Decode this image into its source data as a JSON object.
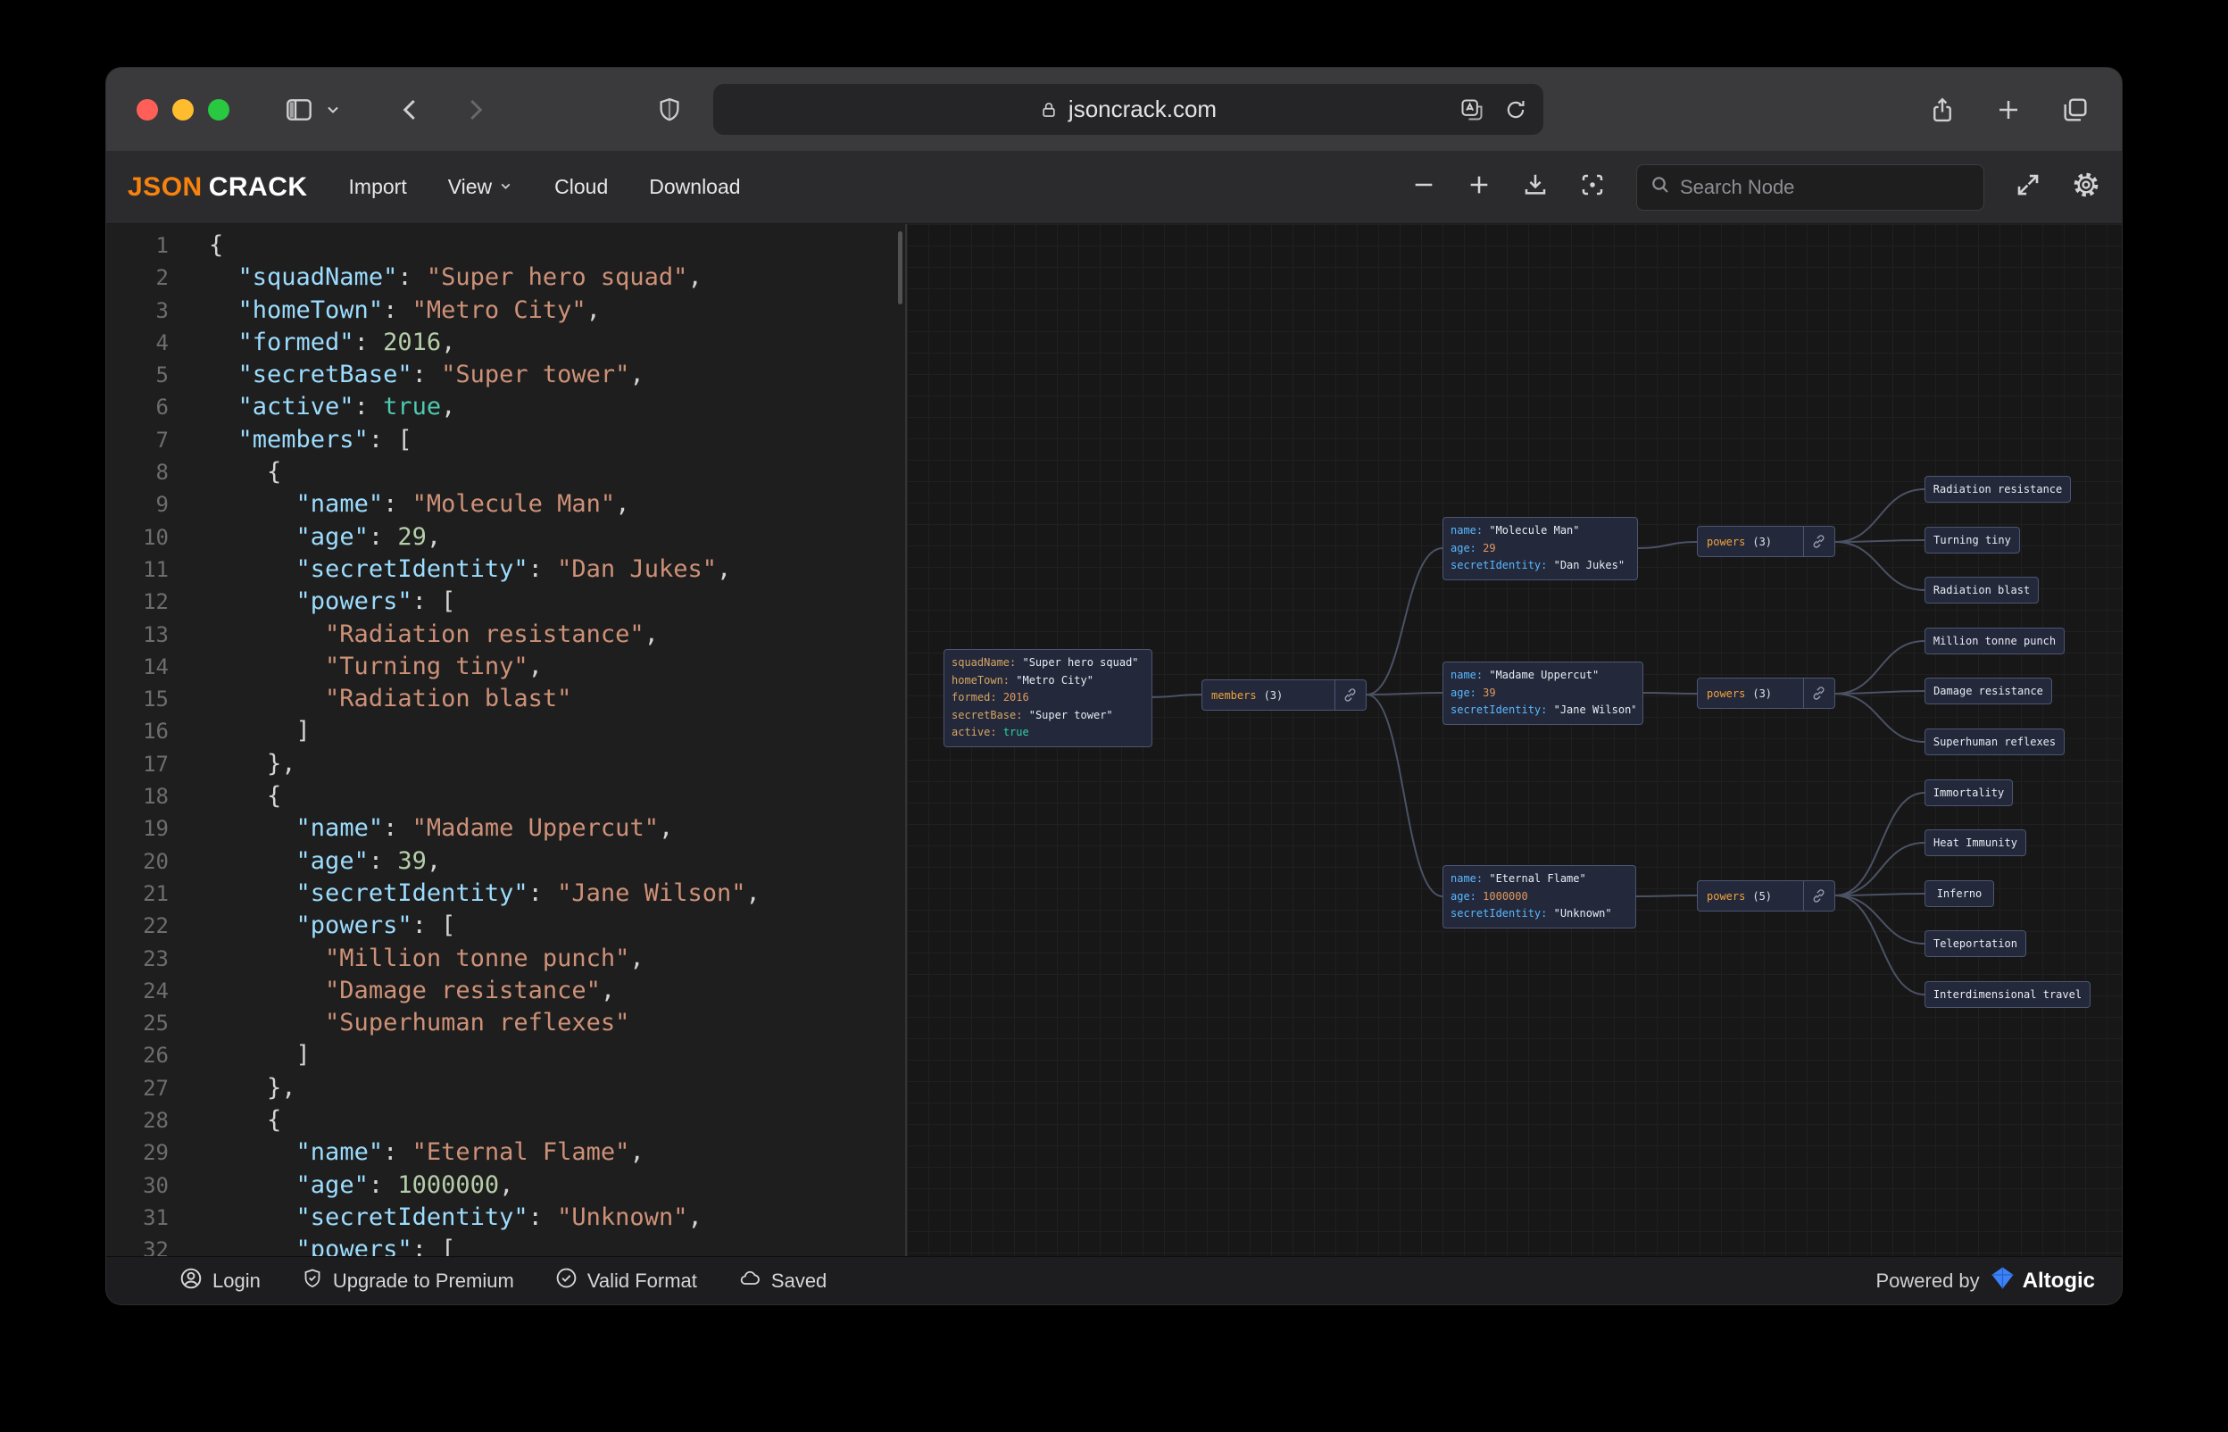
{
  "browser": {
    "url": "jsoncrack.com"
  },
  "toolbar": {
    "logo_json": "JSON",
    "logo_crack": "CRACK",
    "menu": {
      "import": "Import",
      "view": "View",
      "cloud": "Cloud",
      "download": "Download"
    },
    "search_placeholder": "Search Node"
  },
  "editor": {
    "lines": [
      [
        [
          "p",
          "{"
        ]
      ],
      [
        [
          "p",
          "  "
        ],
        [
          "k",
          "\"squadName\""
        ],
        [
          "p",
          ": "
        ],
        [
          "s",
          "\"Super hero squad\""
        ],
        [
          "p",
          ","
        ]
      ],
      [
        [
          "p",
          "  "
        ],
        [
          "k",
          "\"homeTown\""
        ],
        [
          "p",
          ": "
        ],
        [
          "s",
          "\"Metro City\""
        ],
        [
          "p",
          ","
        ]
      ],
      [
        [
          "p",
          "  "
        ],
        [
          "k",
          "\"formed\""
        ],
        [
          "p",
          ": "
        ],
        [
          "n",
          "2016"
        ],
        [
          "p",
          ","
        ]
      ],
      [
        [
          "p",
          "  "
        ],
        [
          "k",
          "\"secretBase\""
        ],
        [
          "p",
          ": "
        ],
        [
          "s",
          "\"Super tower\""
        ],
        [
          "p",
          ","
        ]
      ],
      [
        [
          "p",
          "  "
        ],
        [
          "k",
          "\"active\""
        ],
        [
          "p",
          ": "
        ],
        [
          "b",
          "true"
        ],
        [
          "p",
          ","
        ]
      ],
      [
        [
          "p",
          "  "
        ],
        [
          "k",
          "\"members\""
        ],
        [
          "p",
          ": ["
        ]
      ],
      [
        [
          "p",
          "    {"
        ]
      ],
      [
        [
          "p",
          "      "
        ],
        [
          "k",
          "\"name\""
        ],
        [
          "p",
          ": "
        ],
        [
          "s",
          "\"Molecule Man\""
        ],
        [
          "p",
          ","
        ]
      ],
      [
        [
          "p",
          "      "
        ],
        [
          "k",
          "\"age\""
        ],
        [
          "p",
          ": "
        ],
        [
          "n",
          "29"
        ],
        [
          "p",
          ","
        ]
      ],
      [
        [
          "p",
          "      "
        ],
        [
          "k",
          "\"secretIdentity\""
        ],
        [
          "p",
          ": "
        ],
        [
          "s",
          "\"Dan Jukes\""
        ],
        [
          "p",
          ","
        ]
      ],
      [
        [
          "p",
          "      "
        ],
        [
          "k",
          "\"powers\""
        ],
        [
          "p",
          ": ["
        ]
      ],
      [
        [
          "p",
          "        "
        ],
        [
          "s",
          "\"Radiation resistance\""
        ],
        [
          "p",
          ","
        ]
      ],
      [
        [
          "p",
          "        "
        ],
        [
          "s",
          "\"Turning tiny\""
        ],
        [
          "p",
          ","
        ]
      ],
      [
        [
          "p",
          "        "
        ],
        [
          "s",
          "\"Radiation blast\""
        ]
      ],
      [
        [
          "p",
          "      ]"
        ]
      ],
      [
        [
          "p",
          "    },"
        ]
      ],
      [
        [
          "p",
          "    {"
        ]
      ],
      [
        [
          "p",
          "      "
        ],
        [
          "k",
          "\"name\""
        ],
        [
          "p",
          ": "
        ],
        [
          "s",
          "\"Madame Uppercut\""
        ],
        [
          "p",
          ","
        ]
      ],
      [
        [
          "p",
          "      "
        ],
        [
          "k",
          "\"age\""
        ],
        [
          "p",
          ": "
        ],
        [
          "n",
          "39"
        ],
        [
          "p",
          ","
        ]
      ],
      [
        [
          "p",
          "      "
        ],
        [
          "k",
          "\"secretIdentity\""
        ],
        [
          "p",
          ": "
        ],
        [
          "s",
          "\"Jane Wilson\""
        ],
        [
          "p",
          ","
        ]
      ],
      [
        [
          "p",
          "      "
        ],
        [
          "k",
          "\"powers\""
        ],
        [
          "p",
          ": ["
        ]
      ],
      [
        [
          "p",
          "        "
        ],
        [
          "s",
          "\"Million tonne punch\""
        ],
        [
          "p",
          ","
        ]
      ],
      [
        [
          "p",
          "        "
        ],
        [
          "s",
          "\"Damage resistance\""
        ],
        [
          "p",
          ","
        ]
      ],
      [
        [
          "p",
          "        "
        ],
        [
          "s",
          "\"Superhuman reflexes\""
        ]
      ],
      [
        [
          "p",
          "      ]"
        ]
      ],
      [
        [
          "p",
          "    },"
        ]
      ],
      [
        [
          "p",
          "    {"
        ]
      ],
      [
        [
          "p",
          "      "
        ],
        [
          "k",
          "\"name\""
        ],
        [
          "p",
          ": "
        ],
        [
          "s",
          "\"Eternal Flame\""
        ],
        [
          "p",
          ","
        ]
      ],
      [
        [
          "p",
          "      "
        ],
        [
          "k",
          "\"age\""
        ],
        [
          "p",
          ": "
        ],
        [
          "n",
          "1000000"
        ],
        [
          "p",
          ","
        ]
      ],
      [
        [
          "p",
          "      "
        ],
        [
          "k",
          "\"secretIdentity\""
        ],
        [
          "p",
          ": "
        ],
        [
          "s",
          "\"Unknown\""
        ],
        [
          "p",
          ","
        ]
      ],
      [
        [
          "p",
          "      "
        ],
        [
          "k",
          "\"powers\""
        ],
        [
          "p",
          ": ["
        ]
      ]
    ]
  },
  "graph": {
    "root": {
      "rows": [
        {
          "k": "squadName:",
          "v": "\"Super hero squad\""
        },
        {
          "k": "homeTown:",
          "v": "\"Metro City\""
        },
        {
          "k": "formed:",
          "v": "2016"
        },
        {
          "k": "secretBase:",
          "v": "\"Super tower\""
        },
        {
          "k": "active:",
          "v": "true"
        }
      ]
    },
    "members_label": "members",
    "members_count": "(3)",
    "members": [
      {
        "rows": [
          {
            "k": "name:",
            "v": "\"Molecule Man\""
          },
          {
            "k": "age:",
            "v": "29"
          },
          {
            "k": "secretIdentity:",
            "v": "\"Dan Jukes\""
          }
        ]
      },
      {
        "rows": [
          {
            "k": "name:",
            "v": "\"Madame Uppercut\""
          },
          {
            "k": "age:",
            "v": "39"
          },
          {
            "k": "secretIdentity:",
            "v": "\"Jane Wilson\""
          }
        ]
      },
      {
        "rows": [
          {
            "k": "name:",
            "v": "\"Eternal Flame\""
          },
          {
            "k": "age:",
            "v": "1000000"
          },
          {
            "k": "secretIdentity:",
            "v": "\"Unknown\""
          }
        ]
      }
    ],
    "powers": [
      {
        "label": "powers",
        "count": "(3)"
      },
      {
        "label": "powers",
        "count": "(3)"
      },
      {
        "label": "powers",
        "count": "(5)"
      }
    ],
    "leaves": [
      "Radiation resistance",
      "Turning tiny",
      "Radiation blast",
      "Million tonne punch",
      "Damage resistance",
      "Superhuman reflexes",
      "Immortality",
      "Heat Immunity",
      "Inferno",
      "Teleportation",
      "Interdimensional travel"
    ]
  },
  "statusbar": {
    "login": "Login",
    "upgrade": "Upgrade to Premium",
    "valid": "Valid Format",
    "saved": "Saved",
    "powered_by": "Powered by",
    "brand": "Altogic"
  },
  "colors": {
    "brand_orange": "#f7820d",
    "node_key_blue": "#59b8ff",
    "node_key_gold": "#d7a65f",
    "node_label_orange": "#f2a33c",
    "string_orange": "#ce9178",
    "number_green": "#b5cea8",
    "bool_teal": "#4ec9b0",
    "traffic_red": "#ff5f57",
    "traffic_yellow": "#febc2e",
    "traffic_green": "#28c840",
    "altogic_blue": "#3b82f6"
  }
}
